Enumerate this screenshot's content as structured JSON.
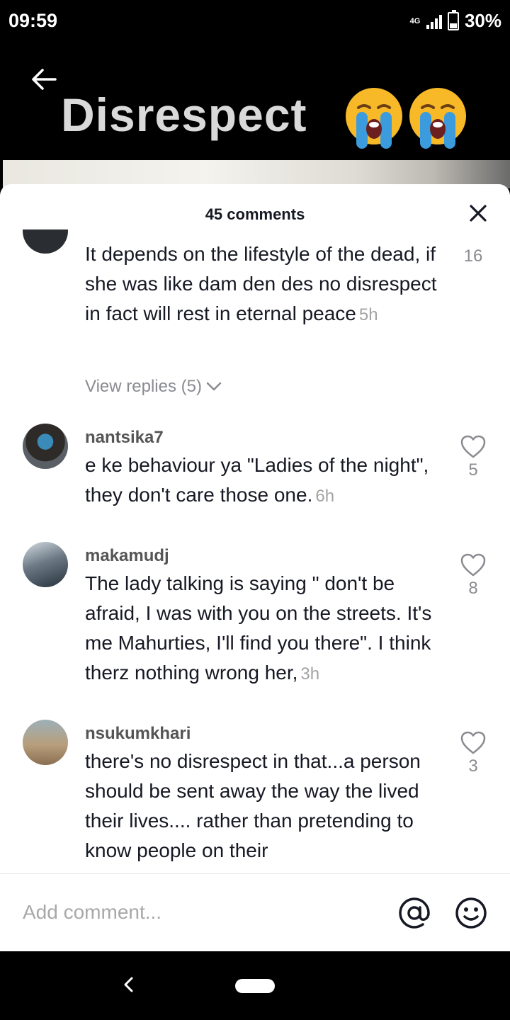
{
  "status_bar": {
    "time": "09:59",
    "network": "4G",
    "battery": "30%",
    "battery_level": 0.3
  },
  "video": {
    "title": "Disrespect",
    "emojis": [
      "loudly-crying-face-icon",
      "loudly-crying-face-icon"
    ]
  },
  "comments_panel": {
    "title": "45 comments",
    "comments": [
      {
        "username": "",
        "text": "It depends on the lifestyle of the dead, if she was like dam den des no disrespect in fact will rest in eternal peace",
        "time": "5h",
        "likes": "16",
        "view_replies": "View replies (5)"
      },
      {
        "username": "nantsika7",
        "text": "e ke behaviour ya \"Ladies of the night\", they don't care those one.",
        "time": "6h",
        "likes": "5"
      },
      {
        "username": "makamudj",
        "text": "The lady talking is saying \" don't be afraid, I was with you on the streets. It's me Mahurties, I'll find you there\". I think therz nothing wrong her,",
        "time": "3h",
        "likes": "8"
      },
      {
        "username": "nsukumkhari",
        "text": "there's no disrespect in that...a person should be sent away the way the lived their lives.... rather than pretending to know people on their",
        "time": "",
        "likes": "3"
      }
    ]
  },
  "input": {
    "placeholder": "Add comment..."
  },
  "colors": {
    "primary_text": "#161823",
    "secondary_text": "#8a8b91",
    "background": "#ffffff"
  }
}
